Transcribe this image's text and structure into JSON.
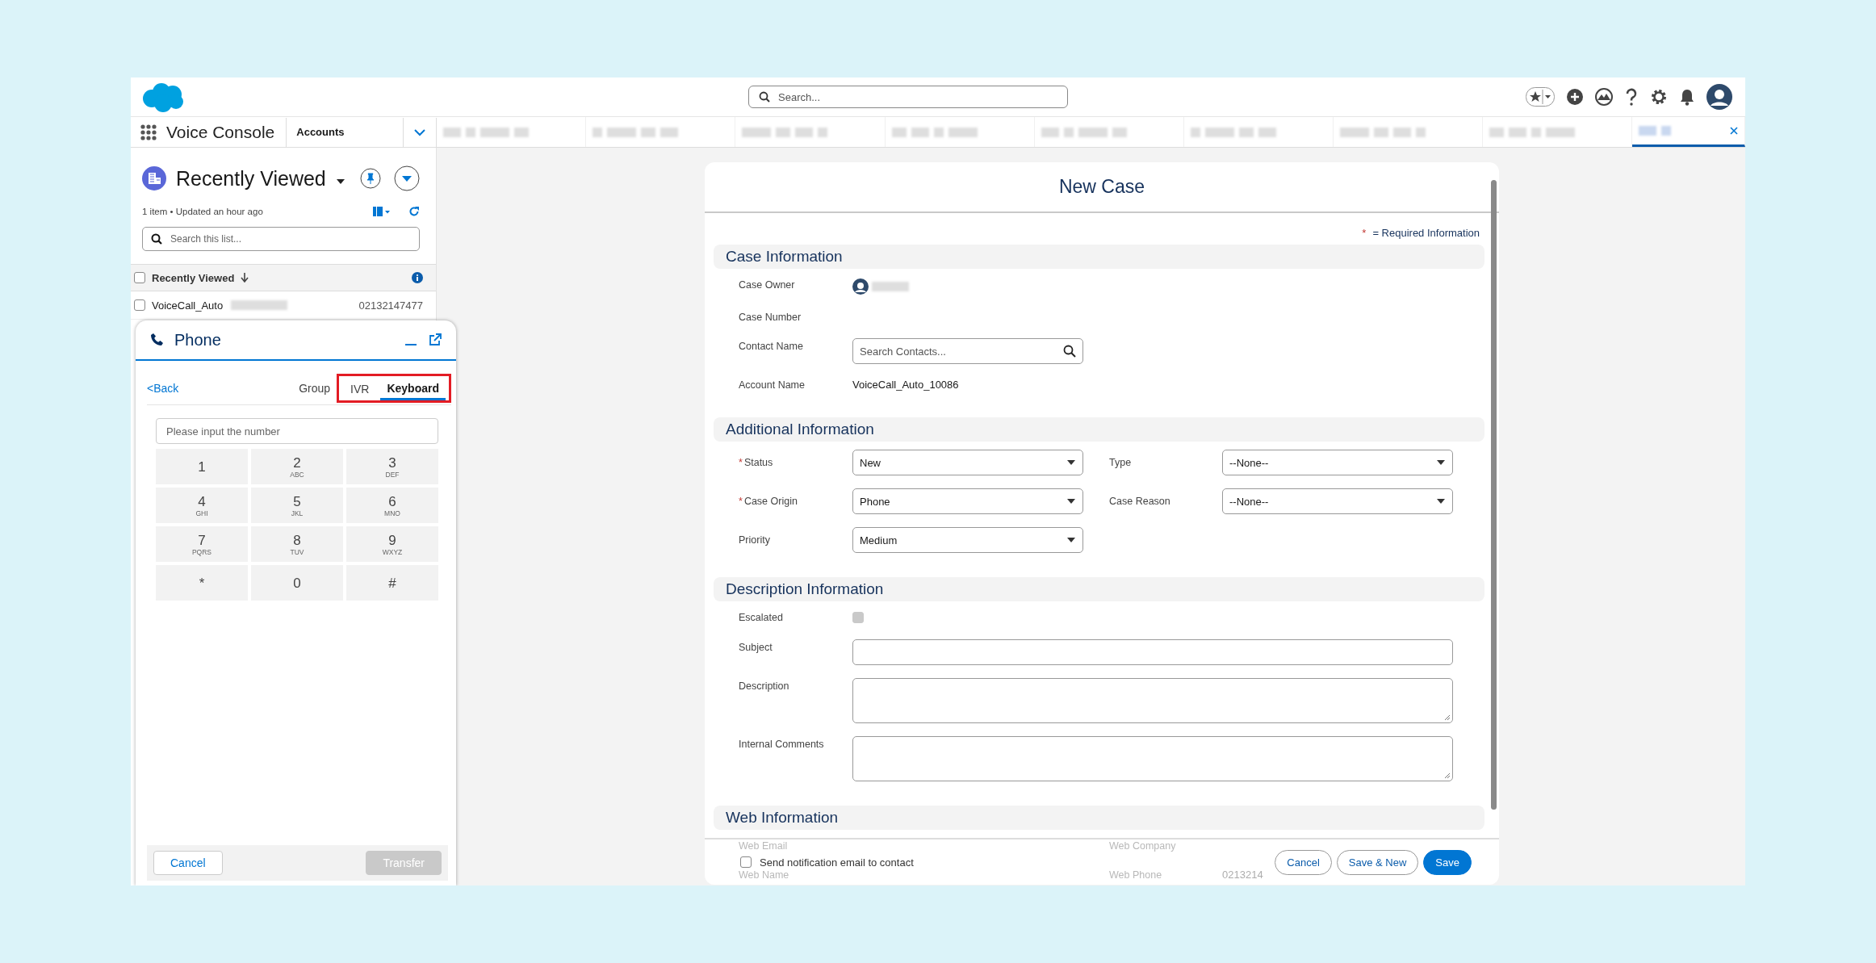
{
  "header": {
    "search": {
      "placeholder": "Search..."
    }
  },
  "nav": {
    "app_name": "Voice Console",
    "object_tab": "Accounts",
    "tabs": [
      {
        "selected": false
      },
      {
        "selected": false
      },
      {
        "selected": false
      },
      {
        "selected": false
      },
      {
        "selected": false
      },
      {
        "selected": false
      },
      {
        "selected": false
      },
      {
        "selected": false
      },
      {
        "selected": true
      }
    ]
  },
  "list_view": {
    "title": "Recently Viewed",
    "meta": "1 item • Updated an hour ago",
    "search": {
      "placeholder": "Search this list..."
    },
    "column": "Recently Viewed",
    "header_checked": false,
    "rows": [
      {
        "name": "VoiceCall_Auto",
        "phone": "02132147477",
        "checked": false
      }
    ]
  },
  "phone": {
    "title": "Phone",
    "back": "<Back",
    "tabs": [
      {
        "label": "Group",
        "selected": false,
        "highlighted": false
      },
      {
        "label": "IVR",
        "selected": false,
        "highlighted": true
      },
      {
        "label": "Keyboard",
        "selected": true,
        "highlighted": true
      }
    ],
    "input": {
      "placeholder": "Please input the number"
    },
    "keys": [
      {
        "digit": "1"
      },
      {
        "digit": "2",
        "letters": "ABC"
      },
      {
        "digit": "3",
        "letters": "DEF"
      },
      {
        "digit": "4",
        "letters": "GHI"
      },
      {
        "digit": "5",
        "letters": "JKL"
      },
      {
        "digit": "6",
        "letters": "MNO"
      },
      {
        "digit": "7",
        "letters": "PQRS"
      },
      {
        "digit": "8",
        "letters": "TUV"
      },
      {
        "digit": "9",
        "letters": "WXYZ"
      },
      {
        "digit": "*"
      },
      {
        "digit": "0"
      },
      {
        "digit": "#"
      }
    ],
    "buttons": [
      {
        "label": "Cancel",
        "disabled": false
      },
      {
        "label": "Transfer",
        "disabled": true
      }
    ]
  },
  "new_case": {
    "title": "New Case",
    "required_mark": "*",
    "required_note": "= Required Information",
    "sections": [
      {
        "title": "Case Information",
        "rows": [
          [
            {
              "label": "Case Owner",
              "kind": "owner",
              "required": false
            }
          ],
          [
            {
              "label": "Case Number",
              "kind": "empty",
              "required": false
            }
          ],
          [
            {
              "label": "Contact Name",
              "kind": "lookup",
              "placeholder": "Search Contacts...",
              "required": false
            }
          ],
          [
            {
              "label": "Account Name",
              "kind": "text",
              "value": "VoiceCall_Auto_10086",
              "required": false
            }
          ]
        ]
      },
      {
        "title": "Additional Information",
        "rows": [
          [
            {
              "label": "Status",
              "kind": "select",
              "value": "New",
              "required": true
            },
            {
              "label": "Type",
              "kind": "select",
              "value": "--None--",
              "required": false
            }
          ],
          [
            {
              "label": "Case Origin",
              "kind": "select",
              "value": "Phone",
              "required": true
            },
            {
              "label": "Case Reason",
              "kind": "select",
              "value": "--None--",
              "required": false
            }
          ],
          [
            {
              "label": "Priority",
              "kind": "select",
              "value": "Medium",
              "required": false
            }
          ]
        ]
      },
      {
        "title": "Description Information",
        "rows": [
          [
            {
              "label": "Escalated",
              "kind": "checkbox",
              "checked": false,
              "disabled": true,
              "required": false
            }
          ],
          [
            {
              "label": "Subject",
              "kind": "input",
              "required": false
            }
          ],
          [
            {
              "label": "Description",
              "kind": "textarea",
              "required": false
            }
          ],
          [
            {
              "label": "Internal Comments",
              "kind": "textarea",
              "required": false
            }
          ]
        ]
      },
      {
        "title": "Web Information",
        "rows": [
          [
            {
              "label": "Web Email",
              "kind": "faded",
              "required": false
            },
            {
              "label": "Web Company",
              "kind": "faded",
              "required": false
            }
          ],
          [
            {
              "label": "Web Name",
              "kind": "faded",
              "required": false
            },
            {
              "label": "Web Phone",
              "kind": "faded",
              "value": "0213214",
              "required": false
            }
          ]
        ]
      }
    ],
    "notify": {
      "label": "Send notification email to contact",
      "checked": false
    },
    "buttons": [
      {
        "label": "Cancel",
        "kind": "neutral"
      },
      {
        "label": "Save & New",
        "kind": "neutral"
      },
      {
        "label": "Save",
        "kind": "brand"
      }
    ]
  }
}
